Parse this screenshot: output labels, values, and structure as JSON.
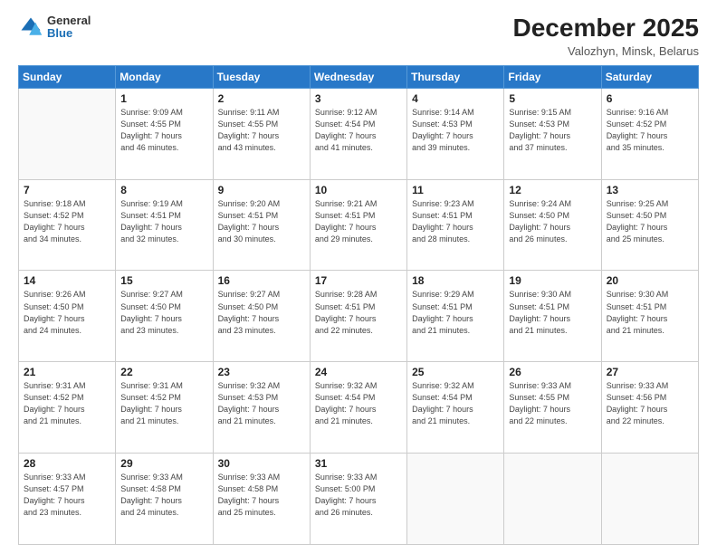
{
  "logo": {
    "general": "General",
    "blue": "Blue"
  },
  "header": {
    "month": "December 2025",
    "location": "Valozhyn, Minsk, Belarus"
  },
  "weekdays": [
    "Sunday",
    "Monday",
    "Tuesday",
    "Wednesday",
    "Thursday",
    "Friday",
    "Saturday"
  ],
  "weeks": [
    [
      {
        "day": "",
        "info": ""
      },
      {
        "day": "1",
        "info": "Sunrise: 9:09 AM\nSunset: 4:55 PM\nDaylight: 7 hours\nand 46 minutes."
      },
      {
        "day": "2",
        "info": "Sunrise: 9:11 AM\nSunset: 4:55 PM\nDaylight: 7 hours\nand 43 minutes."
      },
      {
        "day": "3",
        "info": "Sunrise: 9:12 AM\nSunset: 4:54 PM\nDaylight: 7 hours\nand 41 minutes."
      },
      {
        "day": "4",
        "info": "Sunrise: 9:14 AM\nSunset: 4:53 PM\nDaylight: 7 hours\nand 39 minutes."
      },
      {
        "day": "5",
        "info": "Sunrise: 9:15 AM\nSunset: 4:53 PM\nDaylight: 7 hours\nand 37 minutes."
      },
      {
        "day": "6",
        "info": "Sunrise: 9:16 AM\nSunset: 4:52 PM\nDaylight: 7 hours\nand 35 minutes."
      }
    ],
    [
      {
        "day": "7",
        "info": "Sunrise: 9:18 AM\nSunset: 4:52 PM\nDaylight: 7 hours\nand 34 minutes."
      },
      {
        "day": "8",
        "info": "Sunrise: 9:19 AM\nSunset: 4:51 PM\nDaylight: 7 hours\nand 32 minutes."
      },
      {
        "day": "9",
        "info": "Sunrise: 9:20 AM\nSunset: 4:51 PM\nDaylight: 7 hours\nand 30 minutes."
      },
      {
        "day": "10",
        "info": "Sunrise: 9:21 AM\nSunset: 4:51 PM\nDaylight: 7 hours\nand 29 minutes."
      },
      {
        "day": "11",
        "info": "Sunrise: 9:23 AM\nSunset: 4:51 PM\nDaylight: 7 hours\nand 28 minutes."
      },
      {
        "day": "12",
        "info": "Sunrise: 9:24 AM\nSunset: 4:50 PM\nDaylight: 7 hours\nand 26 minutes."
      },
      {
        "day": "13",
        "info": "Sunrise: 9:25 AM\nSunset: 4:50 PM\nDaylight: 7 hours\nand 25 minutes."
      }
    ],
    [
      {
        "day": "14",
        "info": "Sunrise: 9:26 AM\nSunset: 4:50 PM\nDaylight: 7 hours\nand 24 minutes."
      },
      {
        "day": "15",
        "info": "Sunrise: 9:27 AM\nSunset: 4:50 PM\nDaylight: 7 hours\nand 23 minutes."
      },
      {
        "day": "16",
        "info": "Sunrise: 9:27 AM\nSunset: 4:50 PM\nDaylight: 7 hours\nand 23 minutes."
      },
      {
        "day": "17",
        "info": "Sunrise: 9:28 AM\nSunset: 4:51 PM\nDaylight: 7 hours\nand 22 minutes."
      },
      {
        "day": "18",
        "info": "Sunrise: 9:29 AM\nSunset: 4:51 PM\nDaylight: 7 hours\nand 21 minutes."
      },
      {
        "day": "19",
        "info": "Sunrise: 9:30 AM\nSunset: 4:51 PM\nDaylight: 7 hours\nand 21 minutes."
      },
      {
        "day": "20",
        "info": "Sunrise: 9:30 AM\nSunset: 4:51 PM\nDaylight: 7 hours\nand 21 minutes."
      }
    ],
    [
      {
        "day": "21",
        "info": "Sunrise: 9:31 AM\nSunset: 4:52 PM\nDaylight: 7 hours\nand 21 minutes."
      },
      {
        "day": "22",
        "info": "Sunrise: 9:31 AM\nSunset: 4:52 PM\nDaylight: 7 hours\nand 21 minutes."
      },
      {
        "day": "23",
        "info": "Sunrise: 9:32 AM\nSunset: 4:53 PM\nDaylight: 7 hours\nand 21 minutes."
      },
      {
        "day": "24",
        "info": "Sunrise: 9:32 AM\nSunset: 4:54 PM\nDaylight: 7 hours\nand 21 minutes."
      },
      {
        "day": "25",
        "info": "Sunrise: 9:32 AM\nSunset: 4:54 PM\nDaylight: 7 hours\nand 21 minutes."
      },
      {
        "day": "26",
        "info": "Sunrise: 9:33 AM\nSunset: 4:55 PM\nDaylight: 7 hours\nand 22 minutes."
      },
      {
        "day": "27",
        "info": "Sunrise: 9:33 AM\nSunset: 4:56 PM\nDaylight: 7 hours\nand 22 minutes."
      }
    ],
    [
      {
        "day": "28",
        "info": "Sunrise: 9:33 AM\nSunset: 4:57 PM\nDaylight: 7 hours\nand 23 minutes."
      },
      {
        "day": "29",
        "info": "Sunrise: 9:33 AM\nSunset: 4:58 PM\nDaylight: 7 hours\nand 24 minutes."
      },
      {
        "day": "30",
        "info": "Sunrise: 9:33 AM\nSunset: 4:58 PM\nDaylight: 7 hours\nand 25 minutes."
      },
      {
        "day": "31",
        "info": "Sunrise: 9:33 AM\nSunset: 5:00 PM\nDaylight: 7 hours\nand 26 minutes."
      },
      {
        "day": "",
        "info": ""
      },
      {
        "day": "",
        "info": ""
      },
      {
        "day": "",
        "info": ""
      }
    ]
  ]
}
